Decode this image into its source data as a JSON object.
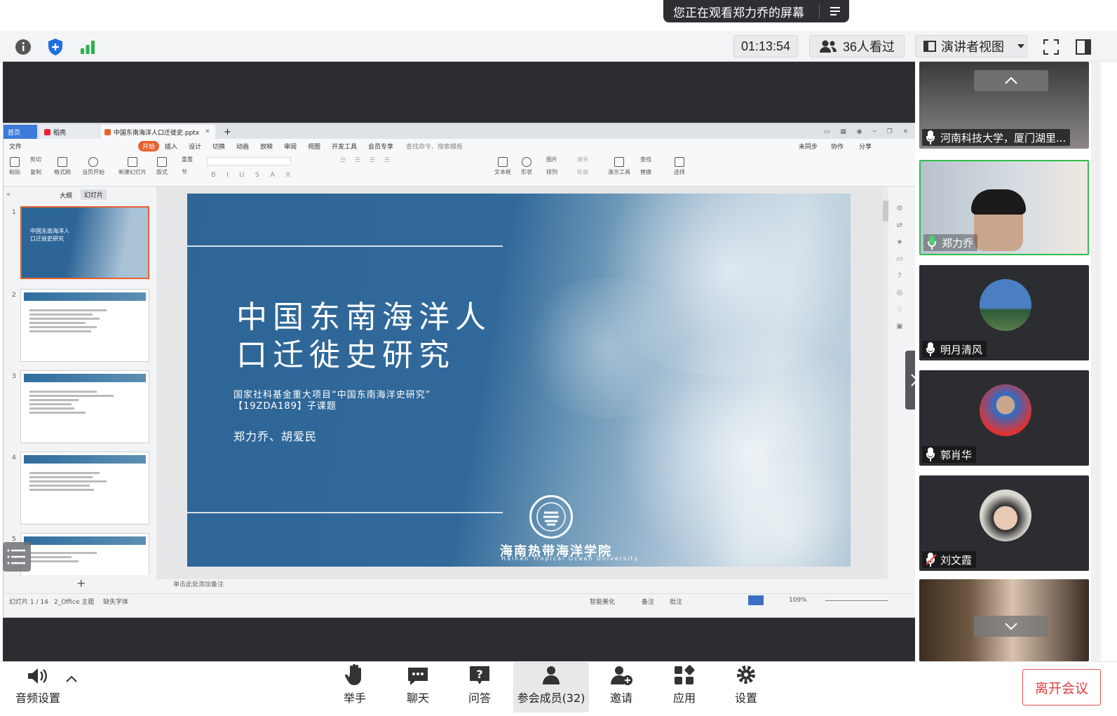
{
  "banner": {
    "text": "您正在观看郑力乔的屏幕"
  },
  "topbar": {
    "timer": "01:13:54",
    "viewers": "36人看过",
    "view_mode": "演讲者视图"
  },
  "wps": {
    "tabs": [
      "首页",
      "稻壳",
      "中国东南海洋人口迁徙史.pptx"
    ],
    "menu": [
      "文件",
      "开始",
      "插入",
      "设计",
      "切换",
      "动画",
      "放映",
      "审阅",
      "视图",
      "开发工具",
      "会员专享",
      "查找命令、搜索模板",
      "未同步",
      "协作",
      "分享"
    ],
    "ribbon": [
      "粘贴",
      "剪切",
      "复制",
      "格式刷",
      "当页开始",
      "新建幻灯片",
      "版式",
      "重置",
      "节",
      "文本框",
      "形状",
      "图片",
      "排列",
      "填充",
      "轮廓",
      "演示工具",
      "查找",
      "替换",
      "选择"
    ],
    "pane_tabs": [
      "大纲",
      "幻灯片"
    ],
    "slide_nums": [
      "1",
      "2",
      "3",
      "4",
      "5"
    ],
    "notes_placeholder": "单击此处添加备注",
    "status": {
      "slide": "幻灯片 1 / 14",
      "theme": "2_Office 主题",
      "font": "缺失字体",
      "beautify": "智能美化",
      "notes": "备注",
      "comment": "批注",
      "zoom": "109%"
    }
  },
  "slide": {
    "title_line1": "中国东南海洋人",
    "title_line2": "口迁徙史研究",
    "subtitle_line1": "国家社科基金重大项目“中国东南海洋史研究”",
    "subtitle_line2": "【19ZDA189】子课题",
    "authors": "郑力乔、胡爱民",
    "logo_cn": "海南热带海洋学院",
    "logo_en": "Hainan Tropical Ocean University"
  },
  "participants": [
    {
      "name": "河南科技大学，厦门湖里...",
      "mic": "on"
    },
    {
      "name": "郑力乔",
      "mic": "speaking"
    },
    {
      "name": "明月清风",
      "mic": "on"
    },
    {
      "name": "郭肖华",
      "mic": "on"
    },
    {
      "name": "刘文霞",
      "mic": "muted"
    }
  ],
  "bottom": {
    "audio": "音频设置",
    "raise": "举手",
    "chat": "聊天",
    "qa": "问答",
    "members": "参会成员(32)",
    "invite": "邀请",
    "apps": "应用",
    "settings": "设置",
    "leave": "离开会议"
  },
  "colors": {
    "slide_blue": "#2d6597",
    "leave_red": "#e04040",
    "speaking_green": "#4cd36b"
  }
}
